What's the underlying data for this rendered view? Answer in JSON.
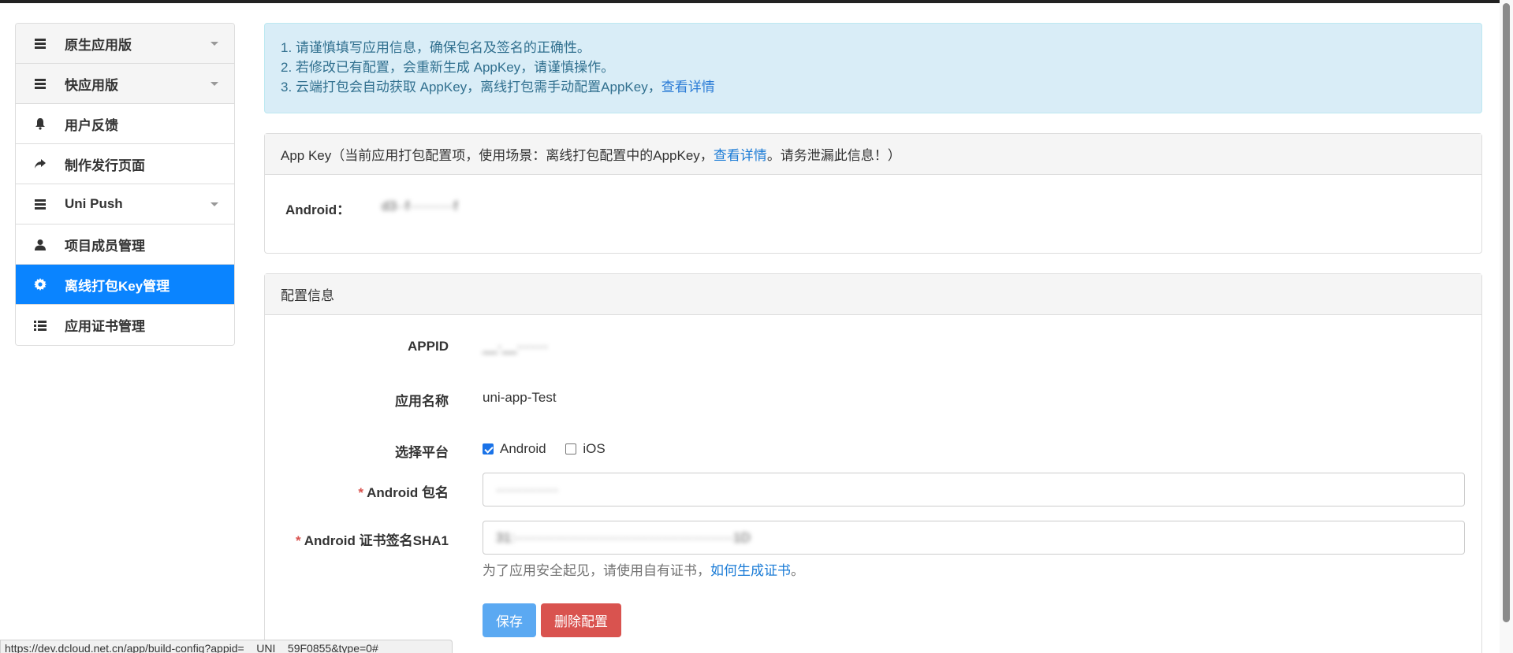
{
  "sidebar": {
    "items": [
      {
        "label": "原生应用版",
        "icon": "list-icon",
        "has_caret": true
      },
      {
        "label": "快应用版",
        "icon": "list-icon",
        "has_caret": true
      },
      {
        "label": "用户反馈",
        "icon": "bell-icon"
      },
      {
        "label": "制作发行页面",
        "icon": "share-arrow-icon"
      },
      {
        "label": "Uni Push",
        "icon": "list-icon",
        "has_caret": true
      },
      {
        "label": "项目成员管理",
        "icon": "user-icon"
      },
      {
        "label": "离线打包Key管理",
        "icon": "gear-icon",
        "active": true
      },
      {
        "label": "应用证书管理",
        "icon": "list-bullets-icon"
      }
    ]
  },
  "notice": {
    "line1": "1. 请谨慎填写应用信息，确保包名及签名的正确性。",
    "line2": "2. 若修改已有配置，会重新生成 AppKey，请谨慎操作。",
    "line3_text": "3. 云端打包会自动获取 AppKey，离线打包需手动配置AppKey，",
    "line3_link": "查看详情"
  },
  "appkey_panel": {
    "heading_prefix": "App Key（当前应用打包配置项，使用场景：离线打包配置中的AppKey，",
    "heading_link": "查看详情",
    "heading_suffix": "。请务泄漏此信息！）",
    "android_label": "Android：",
    "android_value": "d3··f··········f"
  },
  "config_panel": {
    "heading": "配置信息",
    "appid_label": "APPID",
    "appid_value": "__·__·······",
    "name_label": "应用名称",
    "name_value": "uni-app-Test",
    "platform_label": "选择平台",
    "platform_android": "Android",
    "platform_ios": "iOS",
    "package_required": "*",
    "package_label": "Android 包名",
    "package_value": "··············",
    "sha1_required": "*",
    "sha1_label": "Android 证书签名SHA1",
    "sha1_value": "31:·················································1D",
    "help_text": "为了应用安全起见，请使用自有证书，",
    "help_link": "如何生成证书",
    "help_suffix": "。",
    "save_label": "保存",
    "delete_label": "删除配置"
  },
  "status_url": "https://dev.dcloud.net.cn/app/build-config?appid=__UNI__59F0855&type=0#",
  "colors": {
    "active": "#0a84ff",
    "alert_bg": "#d9edf7",
    "link": "#1a7bd6",
    "danger": "#d9534f",
    "save": "#5ba9f2"
  }
}
